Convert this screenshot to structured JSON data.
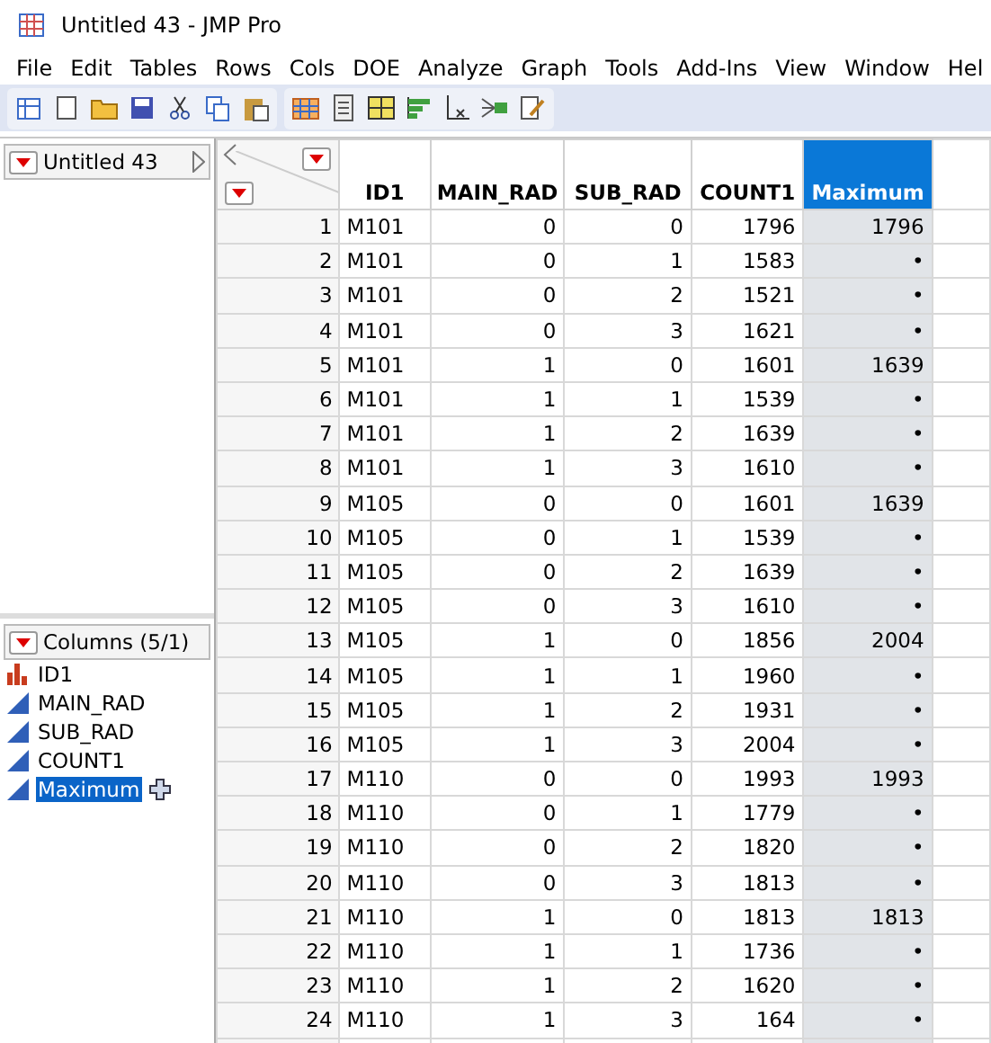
{
  "window": {
    "title": "Untitled 43 - JMP Pro"
  },
  "menu": [
    "File",
    "Edit",
    "Tables",
    "Rows",
    "Cols",
    "DOE",
    "Analyze",
    "Graph",
    "Tools",
    "Add-Ins",
    "View",
    "Window",
    "Hel"
  ],
  "table_panel": {
    "title": "Untitled 43"
  },
  "columns_panel": {
    "title": "Columns (5/1)",
    "items": [
      {
        "name": "ID1",
        "kind": "nominal",
        "selected": false
      },
      {
        "name": "MAIN_RAD",
        "kind": "continuous",
        "selected": false
      },
      {
        "name": "SUB_RAD",
        "kind": "continuous",
        "selected": false
      },
      {
        "name": "COUNT1",
        "kind": "continuous",
        "selected": false
      },
      {
        "name": "Maximum",
        "kind": "continuous",
        "selected": true
      }
    ]
  },
  "table": {
    "columns": [
      {
        "label": "ID1",
        "selected": false
      },
      {
        "label": "MAIN_RAD",
        "selected": false
      },
      {
        "label": "SUB_RAD",
        "selected": false
      },
      {
        "label": "COUNT1",
        "selected": false
      },
      {
        "label": "Maximum",
        "selected": true
      }
    ],
    "rows": [
      {
        "number": "1",
        "cells": [
          "M101",
          "0",
          "0",
          "1796",
          "1796"
        ]
      },
      {
        "number": "2",
        "cells": [
          "M101",
          "0",
          "1",
          "1583",
          "•"
        ]
      },
      {
        "number": "3",
        "cells": [
          "M101",
          "0",
          "2",
          "1521",
          "•"
        ]
      },
      {
        "number": "4",
        "cells": [
          "M101",
          "0",
          "3",
          "1621",
          "•"
        ]
      },
      {
        "number": "5",
        "cells": [
          "M101",
          "1",
          "0",
          "1601",
          "1639"
        ]
      },
      {
        "number": "6",
        "cells": [
          "M101",
          "1",
          "1",
          "1539",
          "•"
        ]
      },
      {
        "number": "7",
        "cells": [
          "M101",
          "1",
          "2",
          "1639",
          "•"
        ]
      },
      {
        "number": "8",
        "cells": [
          "M101",
          "1",
          "3",
          "1610",
          "•"
        ]
      },
      {
        "number": "9",
        "cells": [
          "M105",
          "0",
          "0",
          "1601",
          "1639"
        ]
      },
      {
        "number": "10",
        "cells": [
          "M105",
          "0",
          "1",
          "1539",
          "•"
        ]
      },
      {
        "number": "11",
        "cells": [
          "M105",
          "0",
          "2",
          "1639",
          "•"
        ]
      },
      {
        "number": "12",
        "cells": [
          "M105",
          "0",
          "3",
          "1610",
          "•"
        ]
      },
      {
        "number": "13",
        "cells": [
          "M105",
          "1",
          "0",
          "1856",
          "2004"
        ]
      },
      {
        "number": "14",
        "cells": [
          "M105",
          "1",
          "1",
          "1960",
          "•"
        ]
      },
      {
        "number": "15",
        "cells": [
          "M105",
          "1",
          "2",
          "1931",
          "•"
        ]
      },
      {
        "number": "16",
        "cells": [
          "M105",
          "1",
          "3",
          "2004",
          "•"
        ]
      },
      {
        "number": "17",
        "cells": [
          "M110",
          "0",
          "0",
          "1993",
          "1993"
        ]
      },
      {
        "number": "18",
        "cells": [
          "M110",
          "0",
          "1",
          "1779",
          "•"
        ]
      },
      {
        "number": "19",
        "cells": [
          "M110",
          "0",
          "2",
          "1820",
          "•"
        ]
      },
      {
        "number": "20",
        "cells": [
          "M110",
          "0",
          "3",
          "1813",
          "•"
        ]
      },
      {
        "number": "21",
        "cells": [
          "M110",
          "1",
          "0",
          "1813",
          "1813"
        ]
      },
      {
        "number": "22",
        "cells": [
          "M110",
          "1",
          "1",
          "1736",
          "•"
        ]
      },
      {
        "number": "23",
        "cells": [
          "M110",
          "1",
          "2",
          "1620",
          "•"
        ]
      },
      {
        "number": "24",
        "cells": [
          "M110",
          "1",
          "3",
          "164",
          "•"
        ]
      }
    ]
  }
}
